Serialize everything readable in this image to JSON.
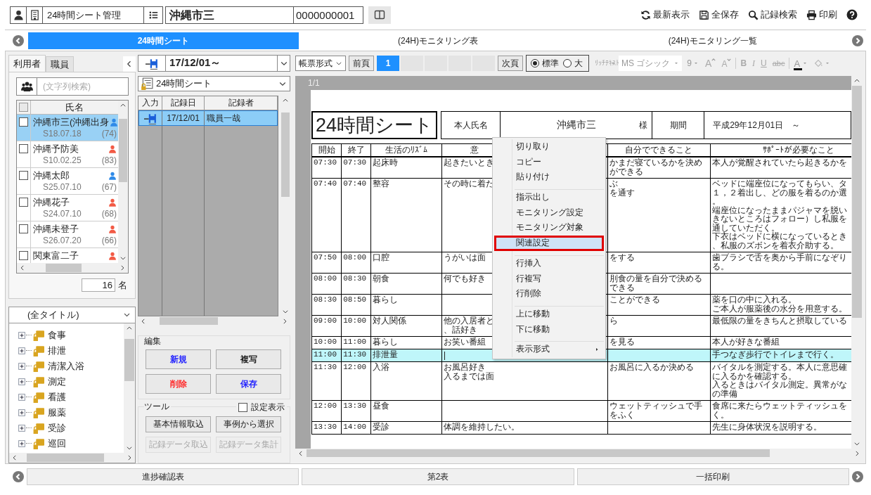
{
  "header": {
    "module": "24時間シート管理",
    "user_name": "沖縄市三",
    "user_id": "0000000001"
  },
  "actions": [
    {
      "label": "最新表示",
      "kind": "refresh"
    },
    {
      "label": "全保存",
      "kind": "save"
    },
    {
      "label": "記録検索",
      "kind": "search"
    },
    {
      "label": "印刷",
      "kind": "print"
    },
    {
      "kind": "help"
    }
  ],
  "tabs": [
    {
      "label": "24時間シート",
      "selected": true
    },
    {
      "label": "(24H)モニタリング表",
      "selected": false
    },
    {
      "label": "(24H)モニタリング一覧",
      "selected": false
    }
  ],
  "users_panel": {
    "tabs": [
      {
        "label": "利用者",
        "selected": true
      },
      {
        "label": "職員",
        "selected": false
      }
    ],
    "search": {
      "placeholder": "(文字列検索)"
    },
    "all_checked": false,
    "column": "氏名",
    "rows": [
      {
        "name": "沖縄市三(沖縄出身",
        "birth": "S18.07.18",
        "age": "(74)",
        "color": "#2f8ae8",
        "checked": false,
        "selected": true
      },
      {
        "name": "沖縄予防美",
        "birth": "S10.02.25",
        "age": "(83)",
        "color": "#f25a45",
        "checked": false,
        "selected": false
      },
      {
        "name": "沖縄太郎",
        "birth": "S25.07.10",
        "age": "(67)",
        "color": "#2f8ae8",
        "checked": false,
        "selected": false
      },
      {
        "name": "沖縄花子",
        "birth": "S24.07.10",
        "age": "(68)",
        "color": "#f25a45",
        "checked": false,
        "selected": false
      },
      {
        "name": "沖縄未登子",
        "birth": "S26.07.20",
        "age": "(66)",
        "color": "#f25a45",
        "checked": false,
        "selected": false
      },
      {
        "name": "関東富二子",
        "color": "#f25a45",
        "checked": false,
        "selected": false
      }
    ],
    "count": "16",
    "count_unit": "名"
  },
  "title_filter": "(全タイトル)",
  "categories": [
    {
      "label": "食事",
      "expanded": false
    },
    {
      "label": "排泄",
      "expanded": false
    },
    {
      "label": "清潔入浴",
      "expanded": false
    },
    {
      "label": "測定",
      "expanded": false
    },
    {
      "label": "看護",
      "expanded": false
    },
    {
      "label": "服薬",
      "expanded": false
    },
    {
      "label": "受診",
      "expanded": false
    },
    {
      "label": "巡回",
      "expanded": false
    }
  ],
  "record_panel": {
    "date": "17/12/01～",
    "sheet": "24時間シート",
    "columns": [
      "入力",
      "記録日",
      "記録者"
    ],
    "rows": [
      {
        "date": "17/12/01",
        "staff": "職員一哉",
        "selected": true
      }
    ]
  },
  "edit": {
    "title": "編集",
    "buttons": [
      {
        "label": "新規",
        "color": "#2020ff"
      },
      {
        "label": "複写",
        "color": "#222222"
      },
      {
        "label": "削除",
        "color": "#ff2a2a"
      },
      {
        "label": "保存",
        "color": "#2020ff"
      }
    ]
  },
  "tools": {
    "title": "ツール",
    "show_settings": {
      "label": "設定表示",
      "checked": false
    },
    "buttons": [
      {
        "label": "基本情報取込",
        "disabled": false
      },
      {
        "label": "事例から選択",
        "disabled": false
      },
      {
        "label": "記録データ取込",
        "disabled": true
      },
      {
        "label": "記録データ集計",
        "disabled": true
      }
    ]
  },
  "toolbar": {
    "format": "帳票形式",
    "prev": "前頁",
    "pages": [
      {
        "label": "1",
        "selected": true
      }
    ],
    "next": "次頁",
    "sizes": [
      {
        "label": "標準",
        "selected": true
      },
      {
        "label": "大",
        "selected": false
      }
    ],
    "rich_text": "ﾘｯﾁﾃｷｽﾄ",
    "font": "MS ゴシック",
    "font_size": "9",
    "text_buttons": [
      {
        "label": "A",
        "kind": "grow"
      },
      {
        "label": "A",
        "kind": "shrink"
      },
      {
        "label": "B",
        "kind": "bold"
      },
      {
        "label": "I",
        "kind": "italic"
      },
      {
        "label": "U",
        "kind": "underline"
      },
      {
        "label": "abc",
        "kind": "strike"
      },
      {
        "label": "A",
        "kind": "color"
      }
    ]
  },
  "document": {
    "page": "1/1",
    "title": "24時間シート",
    "name_label": "本人氏名",
    "name": "沖縄市三",
    "honorific": "様",
    "period_label": "期間",
    "period": "平成29年12月01日　～",
    "columns": [
      "開始",
      "終了",
      "生活のﾘｽﾞﾑ",
      "意",
      "自分でできること",
      "ｻﾎﾟｰﾄが必要なこと"
    ],
    "rows": [
      {
        "start": "07:30",
        "end": "07:30",
        "activity": [
          "起床時"
        ],
        "wish": [
          "起きたいとき"
        ],
        "self": [
          "かまだ寝ているかを決め",
          "ができる"
        ],
        "support": [
          "本人が覚醒されていたら起きるかを"
        ],
        "selected": false
      },
      {
        "start": "07:40",
        "end": "07:40",
        "activity": [
          "整容"
        ],
        "wish": [
          "その時に着た"
        ],
        "self": [
          "ぶ",
          "を通す"
        ],
        "support": [
          "ベッドに端座位になってもらい、タ",
          "１，２着出し、どの服を着るのか選",
          "。",
          "端座位になったままパジャマを脱い",
          "きないところはフォロー）し私服を",
          "通していただく。",
          "下衣はベッドに横になっているとき",
          "、私服のズボンを着衣介助する。"
        ],
        "selected": false
      },
      {
        "start": "07:50",
        "end": "08:00",
        "activity": [
          "口腔"
        ],
        "wish": [
          "うがいは面"
        ],
        "self": [
          "をする"
        ],
        "support": [
          "歯ブラシで舌を奥から手前になぞり",
          "る。"
        ],
        "selected": false
      },
      {
        "start": "08:00",
        "end": "08:30",
        "activity": [
          "朝食"
        ],
        "wish": [
          "何でも好き"
        ],
        "self": [
          "刖食の量を自分で決める",
          "できる"
        ],
        "selected": false
      },
      {
        "start": "08:30",
        "end": "08:50",
        "activity": [
          "暮らし"
        ],
        "self": [
          "ことができる"
        ],
        "support": [
          "薬を口の中に入れる。",
          "ご本人が服薬後の水分を用意する。"
        ],
        "selected": false
      },
      {
        "start": "09:00",
        "end": "10:00",
        "activity": [
          "対人関係"
        ],
        "wish": [
          "他の入居者と",
          "、話好き"
        ],
        "self": [
          "ら"
        ],
        "support": [
          "最低限の量をきちんと摂取している"
        ],
        "selected": false
      },
      {
        "start": "10:00",
        "end": "11:00",
        "activity": [
          "暮らし"
        ],
        "wish": [
          "お笑い番組"
        ],
        "self": [
          "を見る"
        ],
        "support": [
          "本人が好きな番組"
        ],
        "selected": false
      },
      {
        "start": "11:00",
        "end": "11:30",
        "activity": [
          "排泄量"
        ],
        "support": [
          "手つなぎ歩行でトイレまで行く。"
        ],
        "selected": true
      },
      {
        "start": "11:30",
        "end": "12:00",
        "activity": [
          "入浴"
        ],
        "wish": [
          "お風呂好き",
          "入るまでは面"
        ],
        "self": [
          "お風呂に入るか決める"
        ],
        "support": [
          "バイタルを測定する。本人に意思確",
          "に入るかを確認する。",
          "入るときはバイタル測定。異常がな",
          "の準備"
        ],
        "selected": false
      },
      {
        "start": "12:00",
        "end": "13:30",
        "activity": [
          "昼食"
        ],
        "self": [
          "ウェットティッシュで手をふく"
        ],
        "support": [
          "食席に来たらウェットティッシュを",
          "く。"
        ],
        "selected": false
      },
      {
        "start": "13:30",
        "end": "14:00",
        "activity": [
          "受診"
        ],
        "wish": [
          "体調を維持したい。"
        ],
        "support": [
          "先生に身体状況を説明する。"
        ],
        "selected": false
      }
    ]
  },
  "context_menu": [
    [
      {
        "label": "切り取り",
        "selected": false
      },
      {
        "label": "コピー",
        "selected": false
      },
      {
        "label": "貼り付け",
        "selected": false
      }
    ],
    [
      {
        "label": "指示出し",
        "selected": false
      },
      {
        "label": "モニタリング設定",
        "selected": false
      },
      {
        "label": "モニタリング対象",
        "selected": false
      },
      {
        "label": "関連設定",
        "selected": true
      }
    ],
    [
      {
        "label": "行挿入",
        "selected": false
      },
      {
        "label": "行複写",
        "selected": false
      },
      {
        "label": "行削除",
        "selected": false
      }
    ],
    [
      {
        "label": "上に移動",
        "selected": false
      },
      {
        "label": "下に移動",
        "selected": false
      }
    ],
    [
      {
        "label": "表示形式",
        "selected": false,
        "submenu": true
      }
    ]
  ],
  "bottom_tabs": [
    "進捗確認表",
    "第2表",
    "一括印刷"
  ]
}
